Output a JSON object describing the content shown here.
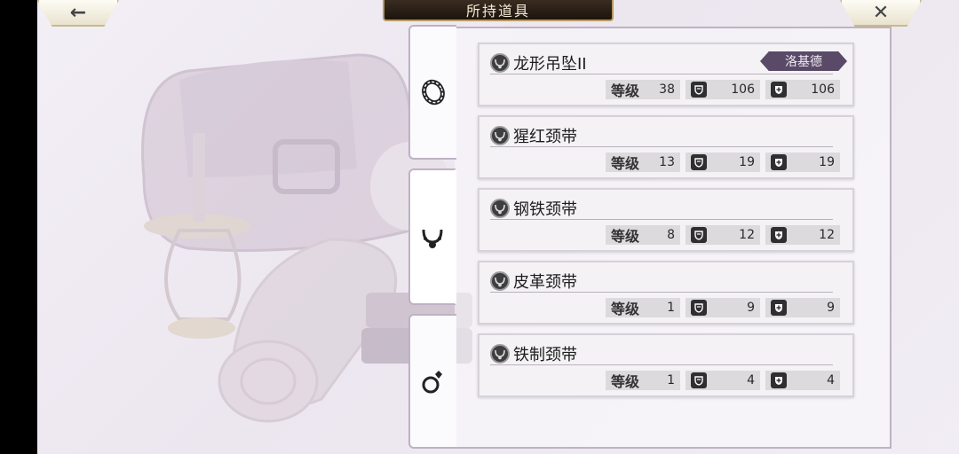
{
  "header": {
    "title": "所持道具",
    "back_icon": "←",
    "close_icon": "✕"
  },
  "tabs": [
    {
      "name": "bracelet-tab",
      "icon": "bracelet-icon"
    },
    {
      "name": "necklace-tab",
      "icon": "necklace-icon"
    },
    {
      "name": "ring-tab",
      "icon": "ring-icon"
    }
  ],
  "stat_label_level": "等级",
  "items": [
    {
      "name": "龙形吊坠II",
      "owner": "洛基德",
      "level": "38",
      "def": "106",
      "res": "106"
    },
    {
      "name": "猩红颈带",
      "owner": "",
      "level": "13",
      "def": "19",
      "res": "19"
    },
    {
      "name": "钢铁颈带",
      "owner": "",
      "level": "8",
      "def": "12",
      "res": "12"
    },
    {
      "name": "皮革颈带",
      "owner": "",
      "level": "1",
      "def": "9",
      "res": "9"
    },
    {
      "name": "铁制颈带",
      "owner": "",
      "level": "1",
      "def": "4",
      "res": "4"
    }
  ],
  "colors": {
    "badge": "#5a4a68",
    "title_bar": "#1b140e",
    "gold_trim": "#b69a62"
  }
}
